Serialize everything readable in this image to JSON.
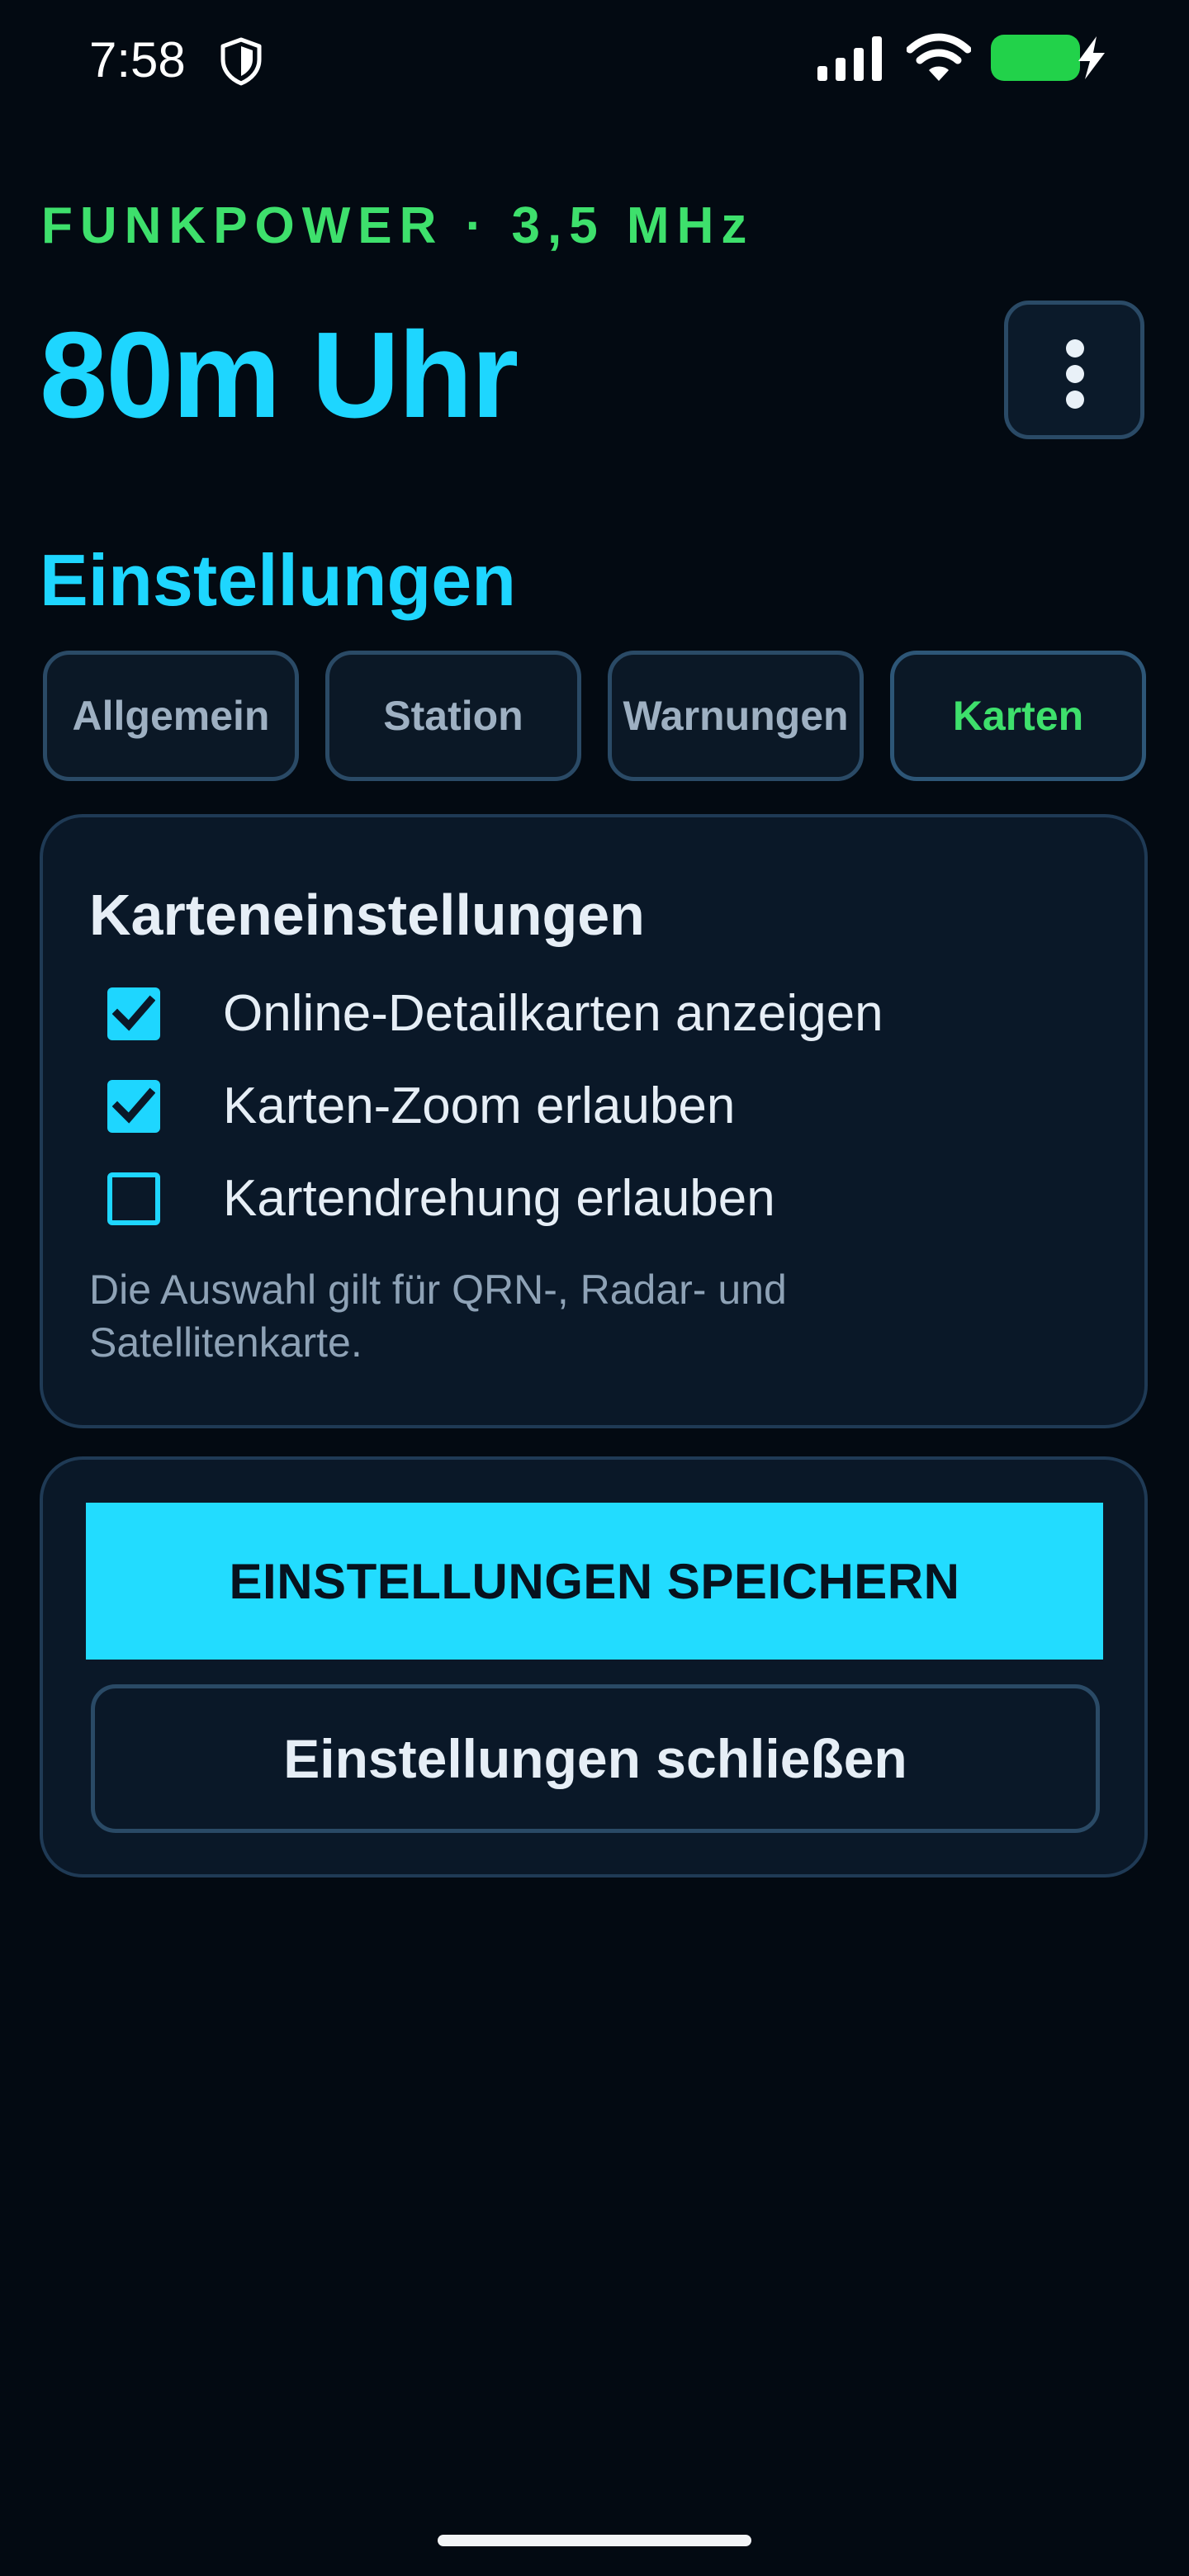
{
  "status_bar": {
    "time": "7:58",
    "icons": [
      "shield-icon",
      "signal-icon",
      "wifi-icon",
      "battery-charging-icon"
    ],
    "battery_color": "#22d24a"
  },
  "header": {
    "eyebrow": "FUNKPOWER · 3,5 MHz",
    "title": "80m Uhr",
    "menu_icon": "more-vertical-icon"
  },
  "settings": {
    "title": "Einstellungen",
    "tabs": [
      {
        "label": "Allgemein",
        "active": false
      },
      {
        "label": "Station",
        "active": false
      },
      {
        "label": "Warnungen",
        "active": false
      },
      {
        "label": "Karten",
        "active": true
      }
    ],
    "map_card": {
      "title": "Karteneinstellungen",
      "options": [
        {
          "label": "Online-Detailkarten anzeigen",
          "checked": true
        },
        {
          "label": "Karten-Zoom erlauben",
          "checked": true
        },
        {
          "label": "Kartendrehung erlauben",
          "checked": false
        }
      ],
      "note": "Die Auswahl gilt für QRN-, Radar- und Satellitenkarte."
    },
    "actions": {
      "save_label": "EINSTELLUNGEN SPEICHERN",
      "close_label": "Einstellungen schließen"
    }
  },
  "colors": {
    "background": "#030a12",
    "accent_cyan": "#1ed6ff",
    "accent_green": "#3ee06c",
    "card_bg": "#0a1828",
    "border": "#2a4a66"
  }
}
